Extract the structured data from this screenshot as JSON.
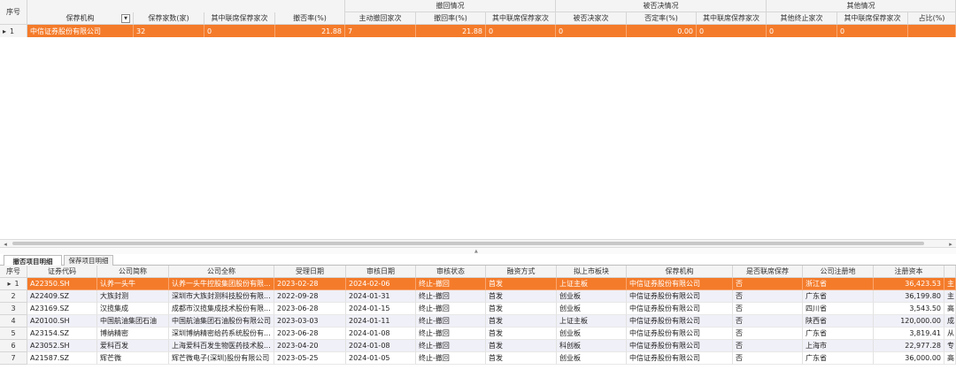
{
  "top": {
    "seq_header": "序号",
    "group_headers": [
      "撤回情况",
      "被否决情况",
      "其他情况"
    ],
    "col_headers": [
      "保荐机构",
      "保荐家数(家)",
      "其中联席保荐家次",
      "撤否率(%)",
      "主动撤回家次",
      "撤回率(%)",
      "其中联席保荐家次",
      "被否决家次",
      "否定率(%)",
      "其中联席保荐家次",
      "其他终止家次",
      "其中联席保荐家次",
      "占比(%)"
    ],
    "filter_icon": "dropdown-filter-icon",
    "row_pointer": "▸",
    "rows": [
      {
        "seq": "1",
        "cells": [
          "中信证券股份有限公司",
          "32",
          "0",
          "21.88",
          "7",
          "21.88",
          "0",
          "0",
          "0.00",
          "0",
          "0",
          "0",
          ""
        ]
      }
    ]
  },
  "tabs": [
    "撤否项目明细",
    "保荐项目明细"
  ],
  "bottom": {
    "col_headers": [
      "序号",
      "证券代码",
      "公司简称",
      "公司全称",
      "受理日期",
      "审核日期",
      "审核状态",
      "融资方式",
      "拟上市板块",
      "保荐机构",
      "是否联席保荐",
      "公司注册地",
      "注册资本",
      ""
    ],
    "rows": [
      [
        "1",
        "A22350.SH",
        "认养一头牛",
        "认养一头牛控股集团股份有限...",
        "2023-02-28",
        "2024-02-06",
        "终止-撤回",
        "首发",
        "上证主板",
        "中信证券股份有限公司",
        "否",
        "浙江省",
        "36,423.53",
        "主"
      ],
      [
        "2",
        "A22409.SZ",
        "大族封测",
        "深圳市大族封测科技股份有限...",
        "2022-09-28",
        "2024-01-31",
        "终止-撤回",
        "首发",
        "创业板",
        "中信证券股份有限公司",
        "否",
        "广东省",
        "36,199.80",
        "主"
      ],
      [
        "3",
        "A23169.SZ",
        "汉揽集成",
        "成都市汉揽集成技术股份有限...",
        "2023-06-28",
        "2024-01-15",
        "终止-撤回",
        "首发",
        "创业板",
        "中信证券股份有限公司",
        "否",
        "四川省",
        "3,543.50",
        "高"
      ],
      [
        "4",
        "A20100.SH",
        "中国航油集团石油",
        "中国航油集团石油股份有限公司",
        "2023-03-03",
        "2024-01-11",
        "终止-撤回",
        "首发",
        "上证主板",
        "中信证券股份有限公司",
        "否",
        "陕西省",
        "120,000.00",
        "成"
      ],
      [
        "5",
        "A23154.SZ",
        "博纳精密",
        "深圳博纳精密给药系统股份有...",
        "2023-06-28",
        "2024-01-08",
        "终止-撤回",
        "首发",
        "创业板",
        "中信证券股份有限公司",
        "否",
        "广东省",
        "3,819.41",
        "从"
      ],
      [
        "6",
        "A23052.SH",
        "爱科百发",
        "上海爱科百发生物医药技术股...",
        "2023-04-20",
        "2024-01-08",
        "终止-撤回",
        "首发",
        "科创板",
        "中信证券股份有限公司",
        "否",
        "上海市",
        "22,977.28",
        "专"
      ],
      [
        "7",
        "A21587.SZ",
        "辉芒微",
        "辉芒微电子(深圳)股份有限公司",
        "2023-05-25",
        "2024-01-05",
        "终止-撤回",
        "首发",
        "创业板",
        "中信证券股份有限公司",
        "否",
        "广东省",
        "36,000.00",
        "高"
      ]
    ]
  }
}
